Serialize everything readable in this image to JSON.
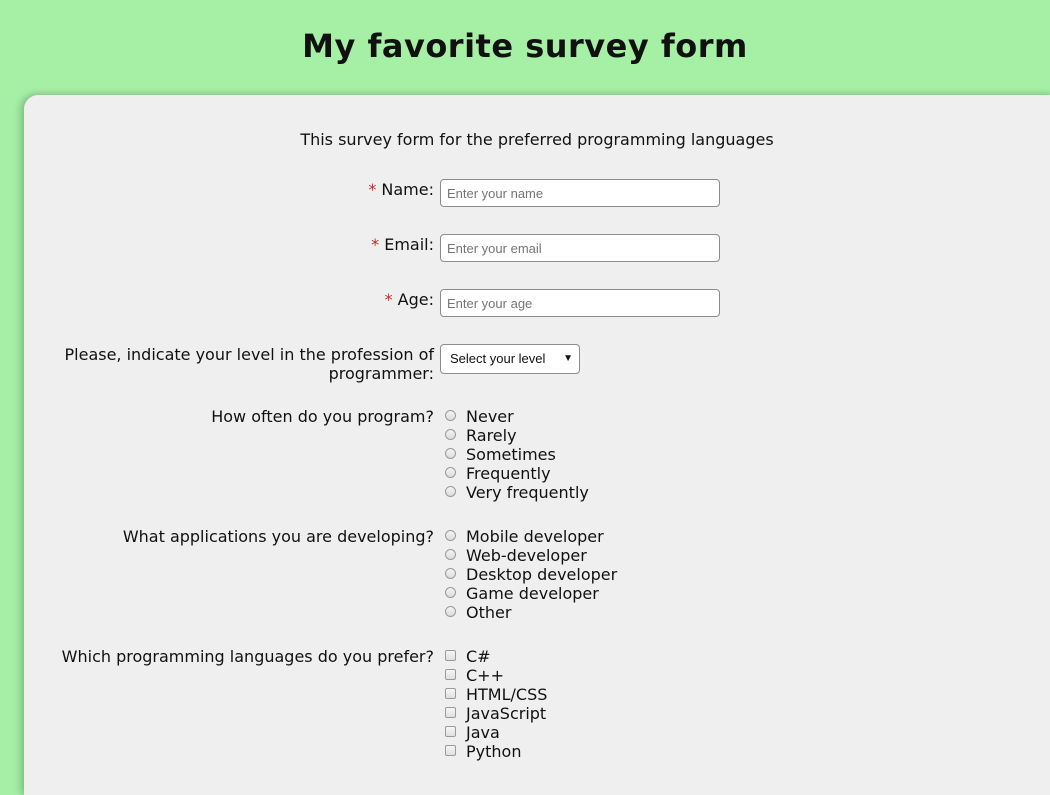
{
  "header": {
    "title": "My favorite survey form"
  },
  "form": {
    "description": "This survey form for the preferred programming languages",
    "name": {
      "label": "Name:",
      "required_mark": "*",
      "placeholder": "Enter your name",
      "value": ""
    },
    "email": {
      "label": "Email:",
      "required_mark": "*",
      "placeholder": "Enter your email",
      "value": ""
    },
    "age": {
      "label": "Age:",
      "required_mark": "*",
      "placeholder": "Enter your age",
      "value": ""
    },
    "level": {
      "label_line1": "Please, indicate your level in the profession of",
      "label_line2": "programmer:",
      "selected": "Select your level"
    },
    "frequency": {
      "label": "How often do you program?",
      "options": [
        "Never",
        "Rarely",
        "Sometimes",
        "Frequently",
        "Very frequently"
      ]
    },
    "applications": {
      "label": "What applications you are developing?",
      "options": [
        "Mobile developer",
        "Web-developer",
        "Desktop developer",
        "Game developer",
        "Other"
      ]
    },
    "languages": {
      "label": "Which programming languages do you prefer?",
      "options": [
        "C#",
        "C++",
        "HTML/CSS",
        "JavaScript",
        "Java",
        "Python"
      ]
    }
  },
  "icons": {
    "select_arrow": "caret-down-icon"
  },
  "colors": {
    "page_background": "#a6f0a6",
    "card_background": "#efefef",
    "required_mark": "#c62828"
  }
}
